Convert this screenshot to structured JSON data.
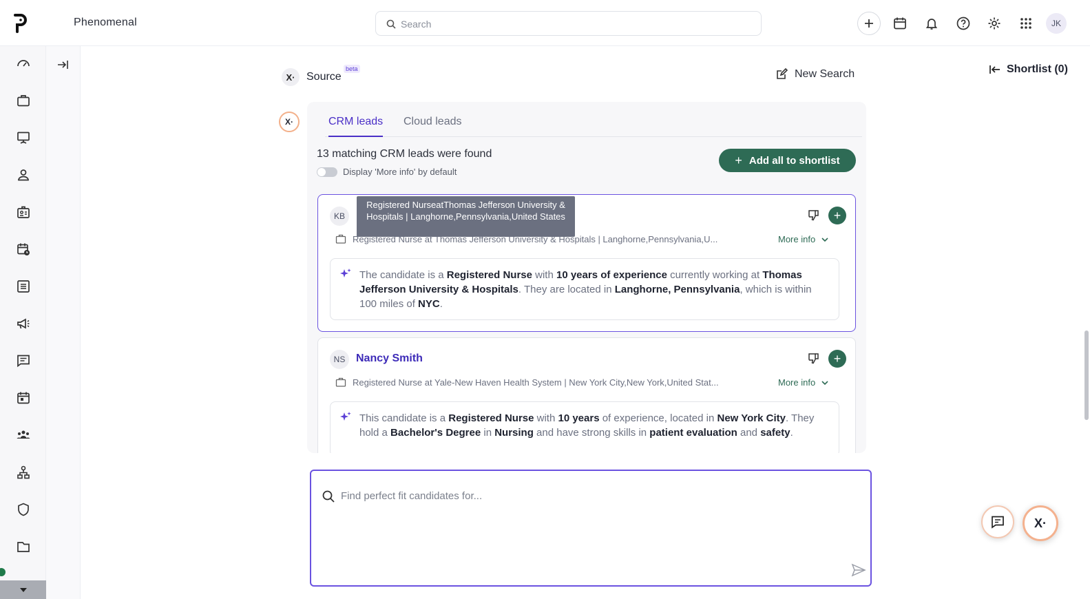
{
  "app": {
    "brand": "Phenomenal",
    "logo_letter": "p"
  },
  "header": {
    "search_placeholder": "Search",
    "avatar_initials": "JK",
    "icons": [
      "plus-icon",
      "calendar-icon",
      "bell-icon",
      "help-icon",
      "gear-icon",
      "apps-grid-icon"
    ]
  },
  "sidebar": {
    "items": [
      "dashboard-icon",
      "briefcase-icon",
      "presentation-icon",
      "person-icon",
      "id-badge-icon",
      "calendar-clock-icon",
      "list-icon",
      "megaphone-icon",
      "message-icon",
      "calendar-icon",
      "team-icon",
      "org-chart-icon",
      "shield-icon",
      "folder-icon"
    ]
  },
  "source": {
    "badge": "X·",
    "title": "Source",
    "beta": "beta",
    "new_search": "New Search",
    "shortlist": "Shortlist (0)"
  },
  "tabs": [
    {
      "label": "CRM leads",
      "active": true
    },
    {
      "label": "Cloud leads",
      "active": false
    }
  ],
  "results": {
    "found_text": "13 matching CRM leads were found",
    "toggle_label": "Display 'More info' by default",
    "add_all": "Add all to shortlist"
  },
  "tooltip": "Registered NurseatThomas Jefferson University & Hospitals | Langhorne,Pennsylvania,United States",
  "candidates": [
    {
      "initials": "KB",
      "name": "",
      "role": "Registered Nurse at Thomas Jefferson University & Hospitals | Langhorne,Pennsylvania,U...",
      "more_info": "More info",
      "summary": [
        {
          "t": "The candidate is a ",
          "b": false
        },
        {
          "t": "Registered Nurse",
          "b": true
        },
        {
          "t": " with ",
          "b": false
        },
        {
          "t": "10 years of experience",
          "b": true
        },
        {
          "t": " currently working at ",
          "b": false
        },
        {
          "t": "Thomas Jefferson University & Hospitals",
          "b": true
        },
        {
          "t": ". They are located in ",
          "b": false
        },
        {
          "t": "Langhorne, Pennsylvania",
          "b": true
        },
        {
          "t": ", which is within 100 miles of ",
          "b": false
        },
        {
          "t": "NYC",
          "b": true
        },
        {
          "t": ".",
          "b": false
        }
      ]
    },
    {
      "initials": "NS",
      "name": "Nancy Smith",
      "role": "Registered Nurse at Yale-New Haven Health System | New York City,New York,United Stat...",
      "more_info": "More info",
      "summary": [
        {
          "t": "This candidate is a ",
          "b": false
        },
        {
          "t": "Registered Nurse",
          "b": true
        },
        {
          "t": " with ",
          "b": false
        },
        {
          "t": "10 years",
          "b": true
        },
        {
          "t": " of experience, located in ",
          "b": false
        },
        {
          "t": "New York City",
          "b": true
        },
        {
          "t": ". They hold a ",
          "b": false
        },
        {
          "t": "Bachelor's Degree",
          "b": true
        },
        {
          "t": " in ",
          "b": false
        },
        {
          "t": "Nursing",
          "b": true
        },
        {
          "t": " and have strong skills in ",
          "b": false
        },
        {
          "t": "patient evaluation",
          "b": true
        },
        {
          "t": " and ",
          "b": false
        },
        {
          "t": "safety",
          "b": true
        },
        {
          "t": ".",
          "b": false
        }
      ]
    }
  ],
  "composer": {
    "placeholder": "Find perfect fit candidates for..."
  },
  "fab": {
    "x_label": "X·"
  },
  "colors": {
    "accent": "#4a2fc7",
    "primary_green": "#2e6b55",
    "border_selected": "#6a52e0"
  }
}
